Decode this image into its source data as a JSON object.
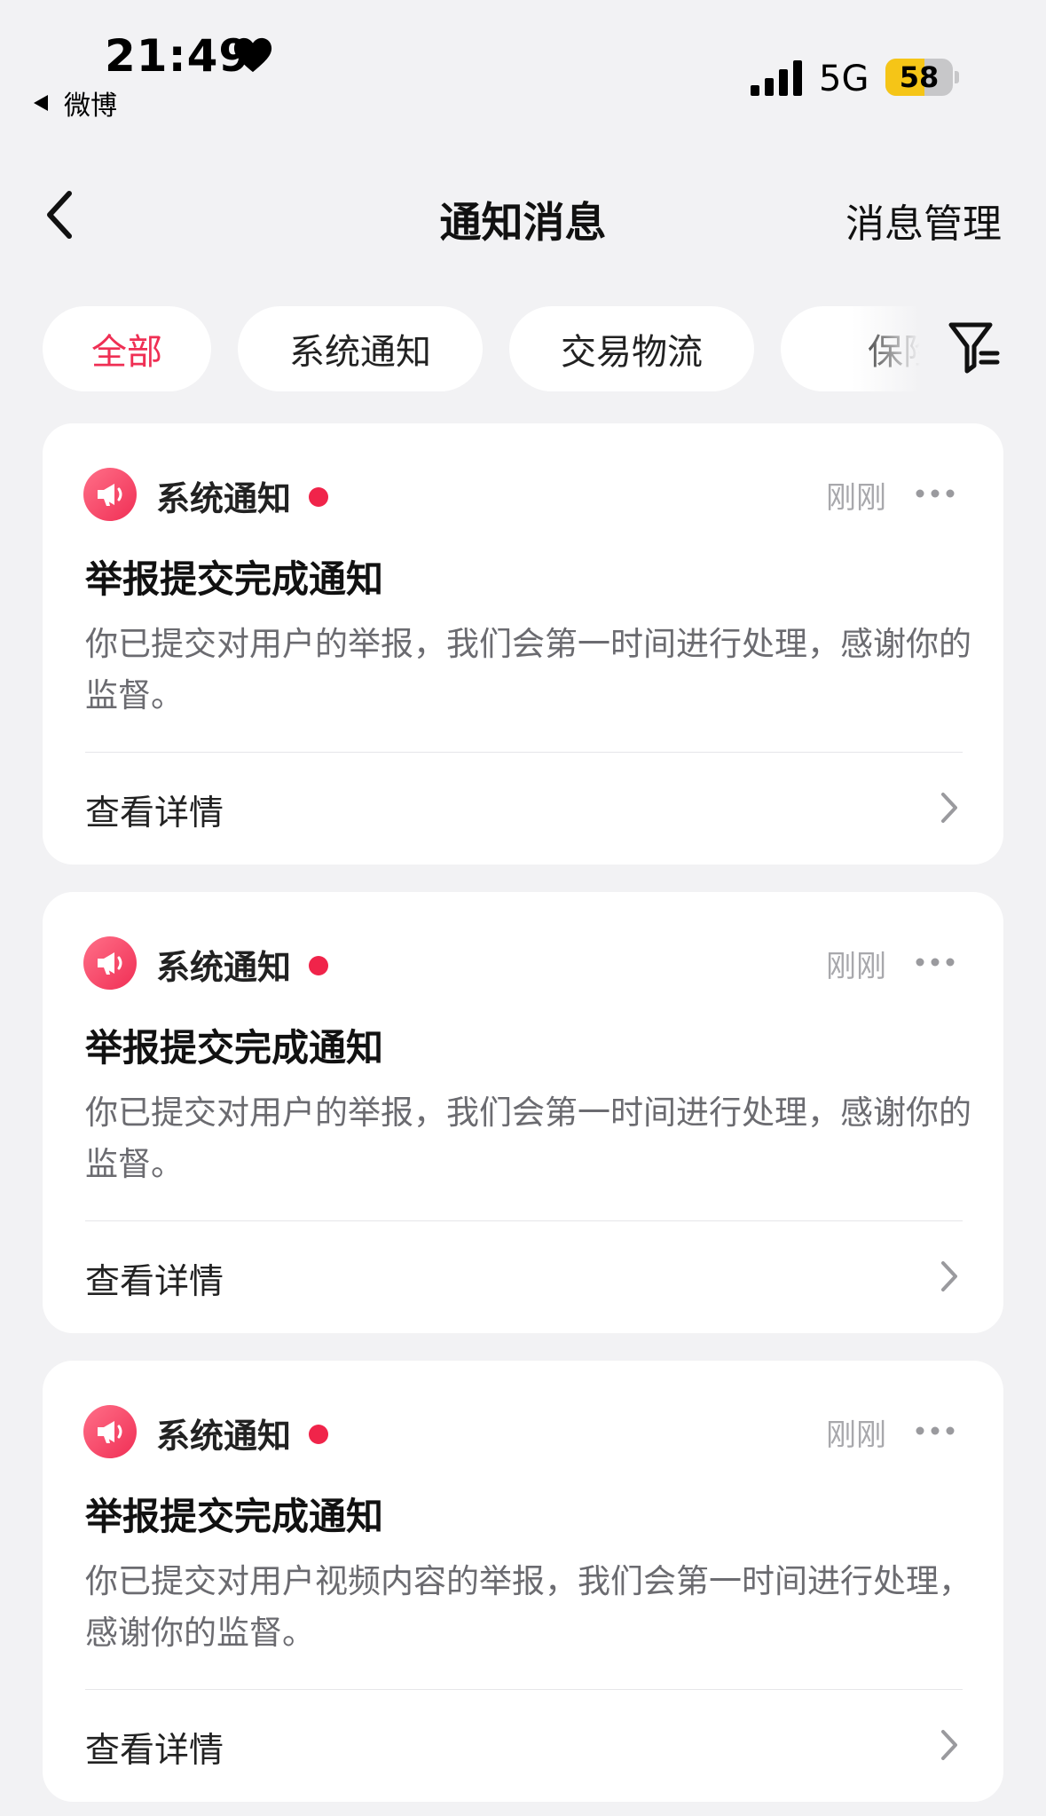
{
  "status_bar": {
    "time": "21:49",
    "back_app": "微博",
    "network": "5G",
    "battery": "58",
    "battery_level": 0.58
  },
  "nav": {
    "title": "通知消息",
    "manage": "消息管理"
  },
  "tabs": [
    {
      "label": "全部",
      "active": true
    },
    {
      "label": "系统通知",
      "active": false
    },
    {
      "label": "交易物流",
      "active": false
    },
    {
      "label": "保险",
      "active": false
    }
  ],
  "notifications": [
    {
      "source": "系统通知",
      "time": "刚刚",
      "title": "举报提交完成通知",
      "body": "你已提交对用户的举报，我们会第一时间进行处理，感谢你的监督。",
      "link": "查看详情"
    },
    {
      "source": "系统通知",
      "time": "刚刚",
      "title": "举报提交完成通知",
      "body": "你已提交对用户的举报，我们会第一时间进行处理，感谢你的监督。",
      "link": "查看详情"
    },
    {
      "source": "系统通知",
      "time": "刚刚",
      "title": "举报提交完成通知",
      "body": "你已提交对用户视频内容的举报，我们会第一时间进行处理，感谢你的监督。",
      "link": "查看详情"
    }
  ],
  "colors": {
    "accent": "#ef2f54",
    "background": "#f2f2f4",
    "battery": "#f5c517"
  },
  "icons": [
    "heart-icon",
    "signal-icon",
    "back-arrow-icon",
    "filter-icon",
    "megaphone-icon",
    "more-icon",
    "chevron-right-icon"
  ]
}
